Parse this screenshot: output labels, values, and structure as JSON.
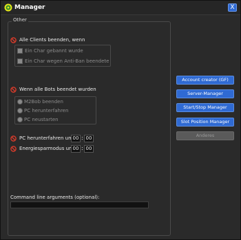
{
  "window": {
    "title": "Manager",
    "close_label": "X"
  },
  "group": {
    "title": "Other"
  },
  "sections": {
    "clients": {
      "label": "Alle Clients beenden, wenn",
      "options": [
        "Ein Char gebannt wurde",
        "Ein Char wegen Anti-Ban beendete"
      ]
    },
    "bots": {
      "label": "Wenn alle Bots beendet wurden",
      "options": [
        "M2Bob beenden",
        "PC herunterfahren",
        "PC neustarten"
      ]
    },
    "shutdown": {
      "label": "PC herunterfahren um:",
      "hour": "00",
      "minute": "00"
    },
    "energy": {
      "label": "Energiesparmodus um:",
      "hour": "00",
      "minute": "00"
    }
  },
  "command_line": {
    "label": "Command line arguments (optional):",
    "value": ""
  },
  "buttons": {
    "account_creator": "Account creator (GF)",
    "server_manager": "Server-Manager",
    "start_stop": "Start/Stop Manager",
    "slot_position": "Slot Position Manager",
    "anderes": "Anderes"
  },
  "colors": {
    "accent": "#2f6ad3",
    "warning": "#d23a2a",
    "background": "#2a2a2a"
  }
}
